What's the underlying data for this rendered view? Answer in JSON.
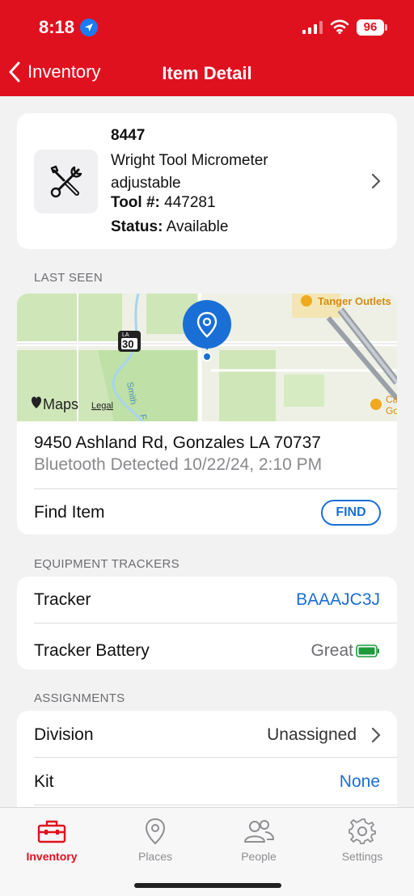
{
  "status_bar": {
    "time": "8:18",
    "battery": "96"
  },
  "nav": {
    "back_label": "Inventory",
    "title": "Item Detail"
  },
  "item": {
    "id": "8447",
    "name": "Wright Tool Micrometer adjustable",
    "tool_label": "Tool #:",
    "tool_number": "447281",
    "status_label": "Status:",
    "status_value": "Available"
  },
  "last_seen": {
    "section_label": "LAST SEEN",
    "map": {
      "poi_1": "Tanger Outlets",
      "poi_2": "Ca",
      "poi_2b": "Go",
      "route_label": "30",
      "route_prefix": "LA",
      "creek_label": "Smith",
      "creek_suffix": "F",
      "maps_label": "Maps",
      "legal_label": "Legal"
    },
    "address": "9450 Ashland Rd, Gonzales LA 70737",
    "detected": "Bluetooth Detected  10/22/24, 2:10 PM",
    "find_label": "Find Item",
    "find_button": "FIND"
  },
  "trackers": {
    "section_label": "EQUIPMENT TRACKERS",
    "tracker_label": "Tracker",
    "tracker_value": "BAAAJC3J",
    "battery_label": "Tracker Battery",
    "battery_value": "Great",
    "battery_level": 1.0
  },
  "assignments": {
    "section_label": "ASSIGNMENTS",
    "division_label": "Division",
    "division_value": "Unassigned",
    "kit_label": "Kit",
    "kit_value": "None"
  },
  "tabs": [
    {
      "label": "Inventory",
      "icon": "toolbox-icon",
      "active": true
    },
    {
      "label": "Places",
      "icon": "map-pin-icon",
      "active": false
    },
    {
      "label": "People",
      "icon": "people-icon",
      "active": false
    },
    {
      "label": "Settings",
      "icon": "gear-icon",
      "active": false
    }
  ],
  "colors": {
    "brand": "#e0111f",
    "link": "#1a6fd6",
    "pin": "#1a6fd6",
    "battery": "#1f9a3a"
  }
}
